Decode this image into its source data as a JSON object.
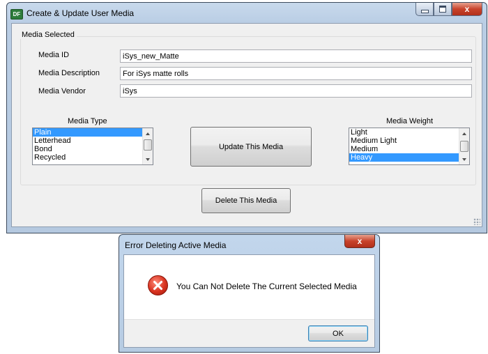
{
  "main_window": {
    "title": "Create & Update User Media",
    "app_icon_text": "DF",
    "close_glyph": "x"
  },
  "media_selected": {
    "legend": "Media Selected",
    "fields": {
      "media_id": {
        "label": "Media ID",
        "value": "iSys_new_Matte"
      },
      "media_description": {
        "label": "Media Description",
        "value": "For iSys matte rolls"
      },
      "media_vendor": {
        "label": "Media Vendor",
        "value": "iSys"
      }
    },
    "media_type": {
      "label": "Media Type",
      "items": [
        "Plain",
        "Letterhead",
        "Bond",
        "Recycled"
      ],
      "selected": "Plain"
    },
    "media_weight": {
      "label": "Media Weight",
      "items": [
        "Light",
        "Medium Light",
        "Medium",
        "Heavy"
      ],
      "selected": "Heavy"
    },
    "update_button": "Update This Media"
  },
  "delete_button": "Delete This Media",
  "error_dialog": {
    "title": "Error Deleting Active Media",
    "close_glyph": "x",
    "message": "You Can Not Delete The Current Selected Media",
    "ok_button": "OK",
    "icon": "error-icon"
  },
  "colors": {
    "selection": "#3399ff",
    "error_red": "#d8321f",
    "title_bar": "#b9cde4"
  }
}
